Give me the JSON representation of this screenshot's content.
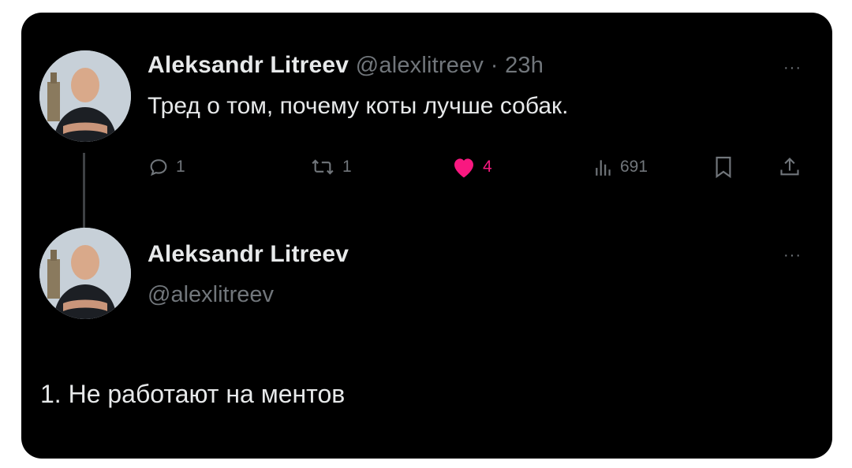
{
  "tweet1": {
    "author_name": "Aleksandr Litreev",
    "handle": "@alexlitreev",
    "separator": "·",
    "time": "23h",
    "text": "Тред о том, почему коты лучше собак.",
    "more_label": "···",
    "actions": {
      "reply_count": "1",
      "retweet_count": "1",
      "like_count": "4",
      "views_count": "691"
    },
    "icons": [
      "reply-icon",
      "retweet-icon",
      "heart-icon",
      "views-icon",
      "bookmark-icon",
      "share-icon"
    ],
    "like_color": "#f91880"
  },
  "tweet2": {
    "author_name": "Aleksandr Litreev",
    "handle": "@alexlitreev",
    "text": "1. Не работают на ментов",
    "more_label": "···"
  }
}
